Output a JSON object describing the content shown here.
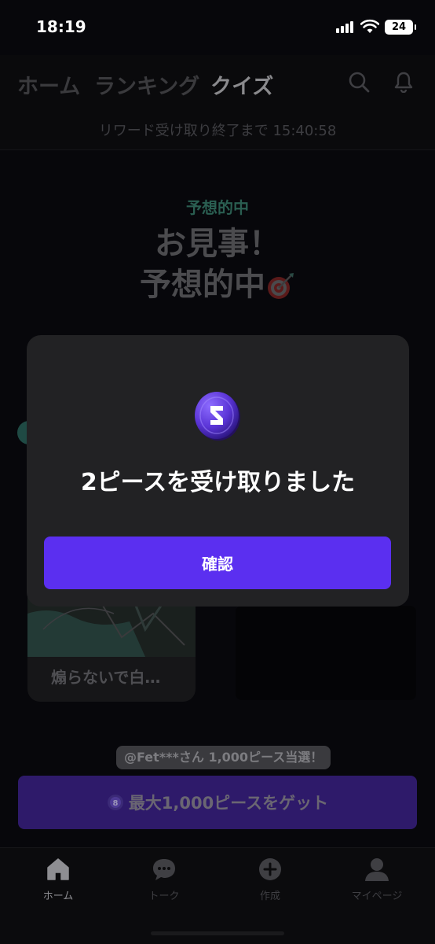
{
  "status": {
    "time": "18:19",
    "battery": "24"
  },
  "header": {
    "tabs": [
      {
        "label": "ホーム",
        "active": false
      },
      {
        "label": "ランキング",
        "active": false
      },
      {
        "label": "クイズ",
        "active": true
      }
    ],
    "countdown": "リワード受け取り終了まで 15:40:58"
  },
  "result": {
    "label": "予想的中",
    "title_line1": "お見事！",
    "title_line2": "予想的中"
  },
  "card": {
    "title": "煽らないで白…"
  },
  "winner_banner": "@Fet***さん 1,000ピース当選！",
  "cta": {
    "label": "最大1,000ピースをゲット"
  },
  "bottom_nav": [
    {
      "label": "ホーム",
      "icon": "home-icon",
      "active": true
    },
    {
      "label": "トーク",
      "icon": "chat-icon",
      "active": false
    },
    {
      "label": "作成",
      "icon": "plus-circle-icon",
      "active": false
    },
    {
      "label": "マイページ",
      "icon": "person-icon",
      "active": false
    }
  ],
  "modal": {
    "message": "2ピースを受け取りました",
    "confirm_label": "確認"
  },
  "colors": {
    "accent": "#5b2ff0",
    "modal_bg": "#222224",
    "result_label": "#2a5e51"
  }
}
